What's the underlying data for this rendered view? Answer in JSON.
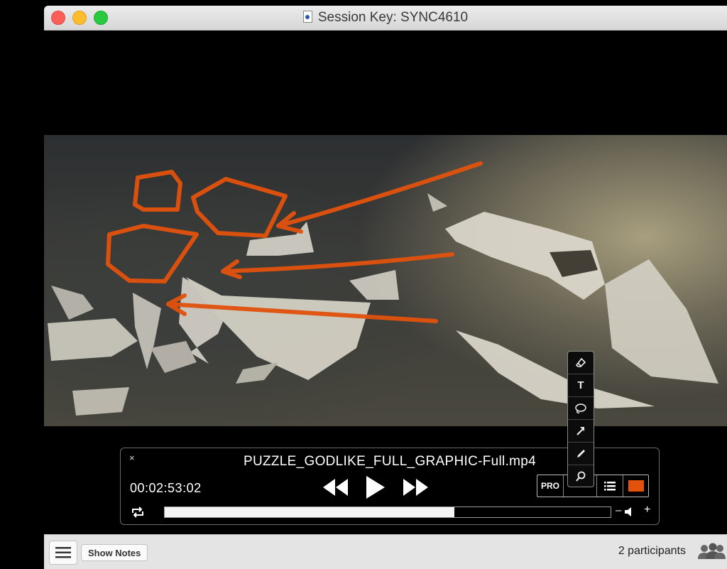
{
  "window": {
    "title": "Session Key: SYNC4610"
  },
  "player": {
    "filename": "PUZZLE_GODLIKE_FULL_GRAPHIC-Full.mp4",
    "timecode": "00:02:53:02",
    "progress": 0.65,
    "pro_label": "PRO",
    "annotation_color": "#e2520d"
  },
  "toolbar": {
    "close": "×",
    "volume_minus": "–",
    "volume_plus": "+",
    "tools": [
      {
        "name": "eraser-icon"
      },
      {
        "name": "text-tool-icon",
        "glyph": "T"
      },
      {
        "name": "lasso-icon"
      },
      {
        "name": "arrow-tool-icon"
      },
      {
        "name": "pen-icon"
      },
      {
        "name": "zoom-icon"
      }
    ]
  },
  "bottom": {
    "show_notes": "Show Notes",
    "participants": "2 participants"
  }
}
